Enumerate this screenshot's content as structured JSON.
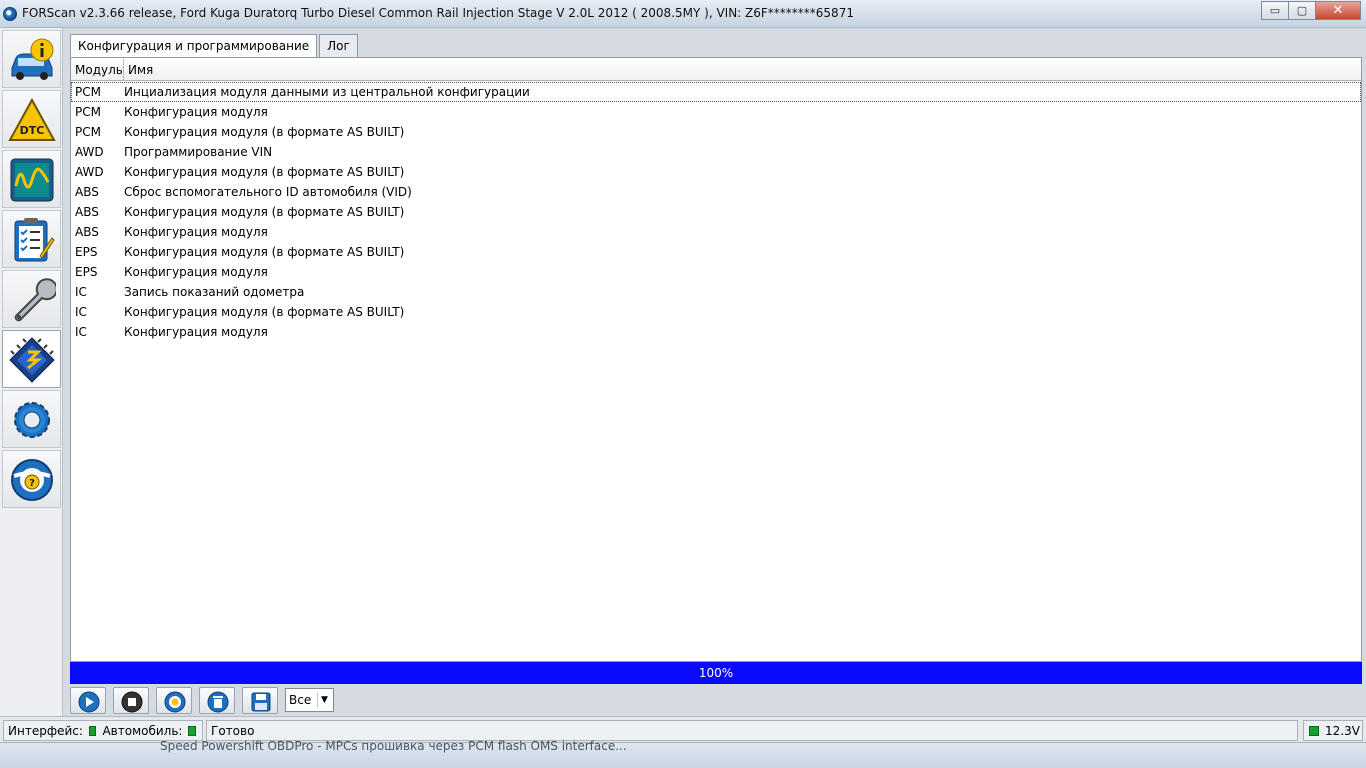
{
  "window": {
    "title": "FORScan v2.3.66 release, Ford Kuga Duratorq Turbo Diesel Common Rail Injection Stage V 2.0L 2012 ( 2008.5MY ), VIN: Z6F********65871",
    "buttons": {
      "minimize": "▭",
      "maximize": "▢",
      "close": "✕"
    }
  },
  "sidebar": {
    "items": [
      {
        "name": "vehicle-info",
        "icon": "car-info-icon"
      },
      {
        "name": "dtc",
        "icon": "dtc-warning-icon",
        "label": "DTC"
      },
      {
        "name": "oscilloscope",
        "icon": "oscilloscope-icon"
      },
      {
        "name": "tests",
        "icon": "checklist-icon"
      },
      {
        "name": "service",
        "icon": "wrench-icon"
      },
      {
        "name": "configuration",
        "icon": "chip-icon",
        "active": true
      },
      {
        "name": "settings",
        "icon": "gear-icon"
      },
      {
        "name": "help",
        "icon": "help-lifebuoy-icon"
      }
    ]
  },
  "tabs": [
    {
      "label": "Конфигурация и программирование",
      "active": true
    },
    {
      "label": "Лог",
      "active": false
    }
  ],
  "table": {
    "columns": {
      "module": "Модуль",
      "name": "Имя"
    },
    "rows": [
      {
        "module": "PCM",
        "name": "Инциализация модуля данными из центральной конфигурации"
      },
      {
        "module": "PCM",
        "name": "Конфигурация модуля"
      },
      {
        "module": "PCM",
        "name": "Конфигурация модуля (в формате AS BUILT)"
      },
      {
        "module": "AWD",
        "name": "Программирование VIN"
      },
      {
        "module": "AWD",
        "name": "Конфигурация модуля (в формате AS BUILT)"
      },
      {
        "module": "ABS",
        "name": "Сброс вспомогательного ID автомобиля (VID)"
      },
      {
        "module": "ABS",
        "name": "Конфигурация модуля (в формате AS BUILT)"
      },
      {
        "module": "ABS",
        "name": "Конфигурация модуля"
      },
      {
        "module": "EPS",
        "name": "Конфигурация модуля (в формате AS BUILT)"
      },
      {
        "module": "EPS",
        "name": "Конфигурация модуля"
      },
      {
        "module": "IC",
        "name": "Запись показаний одометра"
      },
      {
        "module": "IC",
        "name": "Конфигурация модуля (в формате AS BUILT)"
      },
      {
        "module": "IC",
        "name": "Конфигурация модуля"
      }
    ]
  },
  "progress": {
    "text": "100%",
    "value": 1.0,
    "color": "#0a0aff"
  },
  "toolbar": {
    "buttons": [
      "play-icon",
      "stop-icon",
      "help-icon",
      "delete-icon",
      "save-icon"
    ],
    "filter_value": "Все",
    "filter_arrow": "▼"
  },
  "statusbar": {
    "interface_label": "Интерфейс:",
    "vehicle_label": "Автомобиль:",
    "status_text": "Готово",
    "voltage": "12.3V",
    "led_color": "#17a32b"
  },
  "taskbar": {
    "text": "Speed Powershift OBDPro - MPCs прошивка через PCM flash OMS interface..."
  }
}
